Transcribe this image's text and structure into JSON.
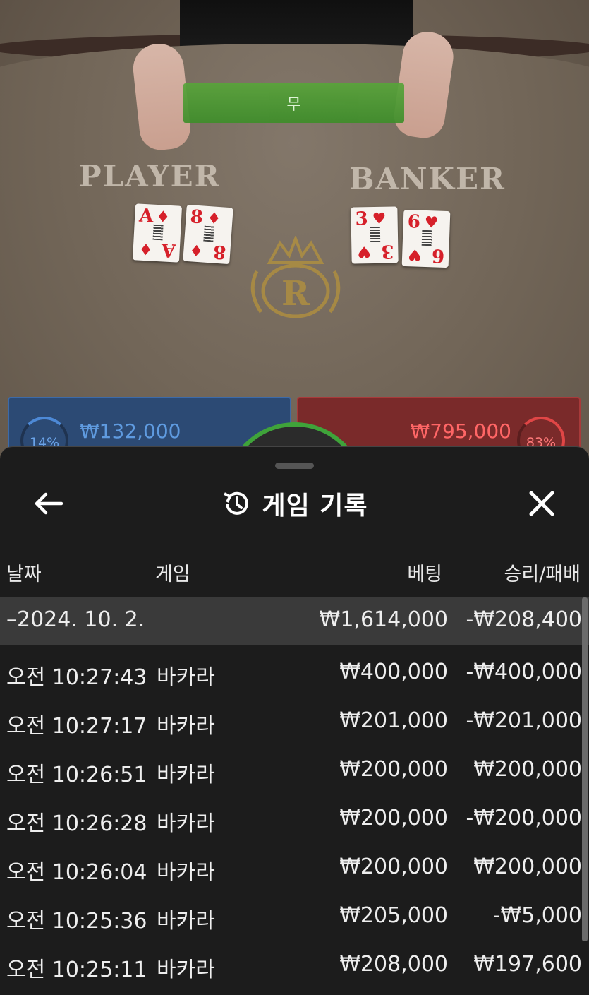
{
  "scene": {
    "result_text": "무",
    "player_label": "PLAYER",
    "banker_label": "BANKER",
    "player_cards": [
      {
        "rank": "A",
        "suit": "♦"
      },
      {
        "rank": "8",
        "suit": "♦"
      }
    ],
    "banker_cards": [
      {
        "rank": "3",
        "suit": "♥"
      },
      {
        "rank": "6",
        "suit": "♥"
      }
    ],
    "logo_letter": "R",
    "player_panel": {
      "percent": "14%",
      "pool": "₩132,000"
    },
    "banker_panel": {
      "percent": "83%",
      "pool": "₩795,000"
    }
  },
  "sheet": {
    "title": "게임 기록",
    "columns": {
      "date": "날짜",
      "game": "게임",
      "bet": "베팅",
      "result": "승리/패배"
    },
    "summary": {
      "date": "–2024. 10. 2.",
      "bet": "₩1,614,000",
      "result": "-₩208,400"
    },
    "rows": [
      {
        "time": "오전 10:27:43",
        "game": "바카라",
        "bet": "₩400,000",
        "result": "-₩400,000"
      },
      {
        "time": "오전 10:27:17",
        "game": "바카라",
        "bet": "₩201,000",
        "result": "-₩201,000"
      },
      {
        "time": "오전 10:26:51",
        "game": "바카라",
        "bet": "₩200,000",
        "result": "₩200,000"
      },
      {
        "time": "오전 10:26:28",
        "game": "바카라",
        "bet": "₩200,000",
        "result": "-₩200,000"
      },
      {
        "time": "오전 10:26:04",
        "game": "바카라",
        "bet": "₩200,000",
        "result": "₩200,000"
      },
      {
        "time": "오전 10:25:36",
        "game": "바카라",
        "bet": "₩205,000",
        "result": "-₩5,000"
      },
      {
        "time": "오전 10:25:11",
        "game": "바카라",
        "bet": "₩208,000",
        "result": "₩197,600"
      }
    ]
  }
}
